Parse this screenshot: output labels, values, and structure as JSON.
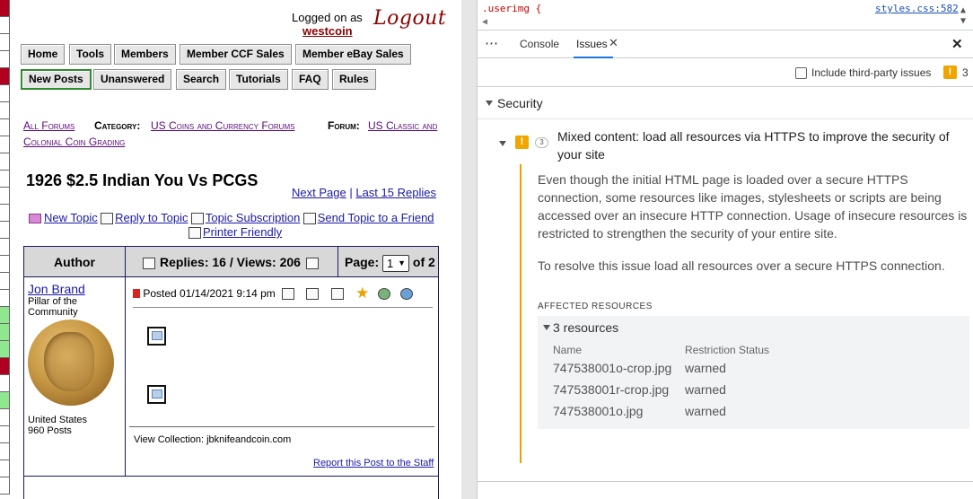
{
  "forum": {
    "login": {
      "prefix": "Logged on as",
      "user": "westcoin",
      "logout": "Logout"
    },
    "nav_row1": [
      "Home",
      "Tools",
      "Members",
      "Member CCF Sales",
      "Member eBay Sales"
    ],
    "nav_row2": [
      "New Posts",
      "Unanswered",
      "Search",
      "Tutorials",
      "FAQ",
      "Rules"
    ],
    "breadcrumb": {
      "all_forums": "All Forums",
      "category_label": "Category:",
      "category": "US Coins and Currency Forums",
      "forum_label": "Forum:",
      "forum_line1": "US Classic and",
      "forum_line2": "Colonial Coin Grading"
    },
    "topic_title": "1926 $2.5 Indian You Vs PCGS",
    "page_links": {
      "next": "Next Page",
      "sep": "|",
      "last": "Last 15 Replies"
    },
    "actions": {
      "new_topic": "New Topic",
      "reply": "Reply to Topic",
      "subscribe": "Topic Subscription",
      "send": "Send Topic to a Friend",
      "printer": "Printer Friendly"
    },
    "table": {
      "author_header": "Author",
      "replies_views": "Replies: 16 / Views: 206",
      "page_label": "Page:",
      "page_value": "1",
      "page_of": "of 2"
    },
    "post": {
      "author": "Jon Brand",
      "rank_line1": "Pillar of the",
      "rank_line2": "Community",
      "location": "United States",
      "posts": "960 Posts",
      "posted": "Posted 01/14/2021  9:14 pm",
      "signature": "View Collection: jbknifeandcoin.com",
      "report": "Report this Post to the Staff"
    }
  },
  "devtools": {
    "css_selector": ".userimg {",
    "css_source": "styles.css:582",
    "tabs": [
      "Console",
      "Issues"
    ],
    "third_party_label": "Include third-party issues",
    "issue_count": "3",
    "section": "Security",
    "issue": {
      "count": "3",
      "title": "Mixed content: load all resources via HTTPS to improve the security of your site",
      "paragraph1": "Even though the initial HTML page is loaded over a secure HTTPS connection, some resources like images, stylesheets or scripts are being accessed over an insecure HTTP connection. Usage of insecure resources is restricted to strengthen the security of your entire site.",
      "paragraph2": "To resolve this issue load all resources over a secure HTTPS connection.",
      "affected_label": "AFFECTED RESOURCES",
      "resources_toggle": "3 resources",
      "col_name": "Name",
      "col_status": "Restriction Status",
      "resources": [
        {
          "name": "747538001o-crop.jpg",
          "status": "warned"
        },
        {
          "name": "747538001r-crop.jpg",
          "status": "warned"
        },
        {
          "name": "747538001o.jpg",
          "status": "warned"
        }
      ]
    }
  },
  "colors": {
    "link_purple": "#5a0a7a",
    "link_blue": "#1a1aa6",
    "accent_blue": "#1a73e8",
    "warning_orange": "#f0a500",
    "nav_active_border": "#2e8b2e"
  }
}
